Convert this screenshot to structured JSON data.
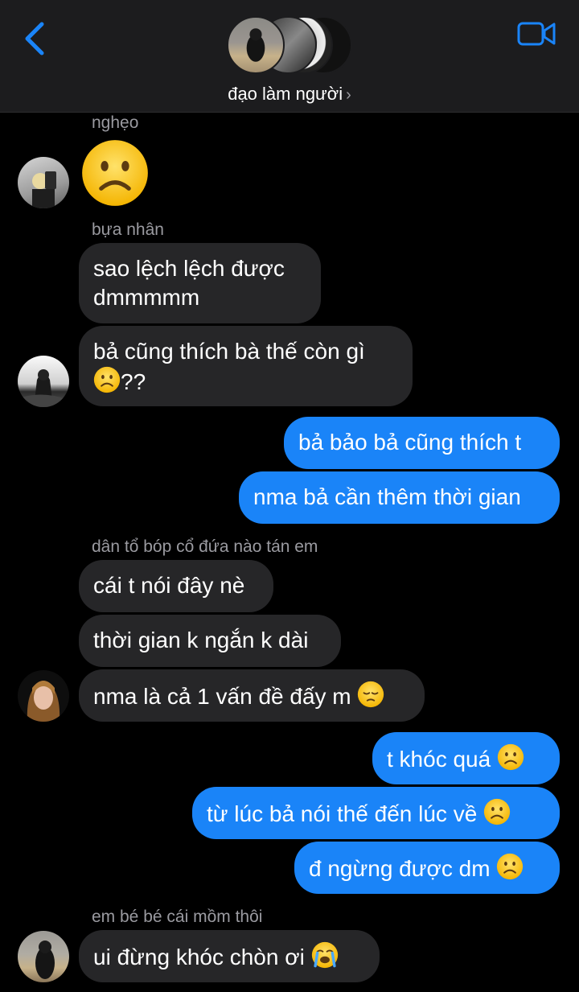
{
  "header": {
    "group_name": "đạo làm người",
    "chevron": "›",
    "back_icon": "chevron-left",
    "video_icon": "video-camera",
    "accent": "#1a84f8"
  },
  "messages": [
    {
      "sender": "nghẹo",
      "type": "emoji",
      "emoji": "frowning-face"
    },
    {
      "sender": "bựa nhân",
      "line1": "sao lệch lệch được",
      "line2": "dmmmmm"
    },
    {
      "line1": "bả cũng thích bà thế còn gì",
      "line2": "??"
    },
    {
      "outgoing": true,
      "text": "bả bảo bả cũng thích t"
    },
    {
      "outgoing": true,
      "text": "nma bả cần thêm thời gian"
    },
    {
      "sender": "dân tổ bóp cổ đứa nào tán em",
      "text": "cái t nói đây nè"
    },
    {
      "text": "thời gian k ngắn k dài"
    },
    {
      "text": "nma là cả 1 vấn đề đấy m"
    },
    {
      "outgoing": true,
      "text": "t khóc quá"
    },
    {
      "outgoing": true,
      "text": "từ lúc bả nói thế đến lúc về"
    },
    {
      "outgoing": true,
      "text": "đ ngừng được dm"
    },
    {
      "sender": "em bé bé cái mồm thôi",
      "text": "ui đừng khóc chòn ơi"
    }
  ],
  "colors": {
    "incoming_bubble": "#262628",
    "outgoing_bubble": "#1a84f8",
    "background": "#000000"
  }
}
